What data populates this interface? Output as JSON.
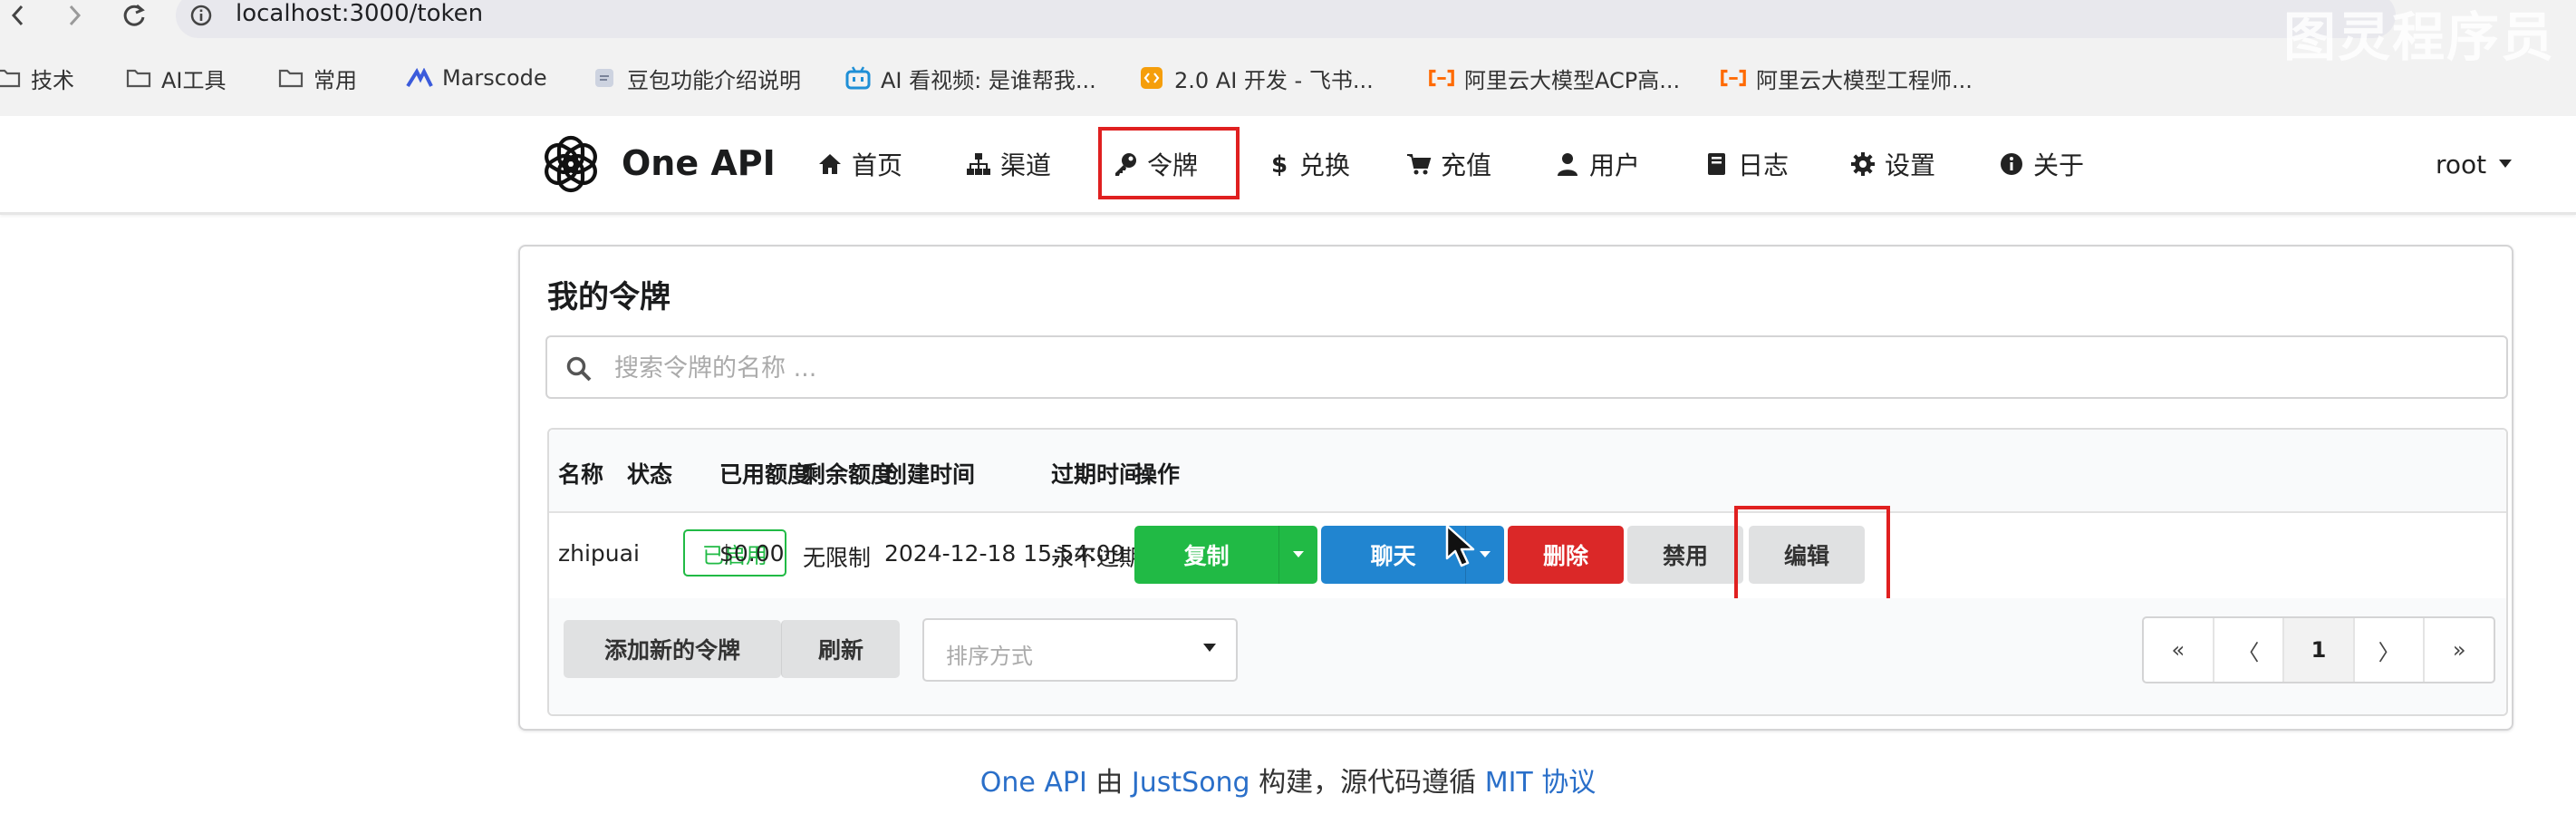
{
  "browser": {
    "url": "localhost:3000/token",
    "watermark": "图灵程序员",
    "bookmarks": [
      {
        "label": "技术",
        "icon": "folder-icon"
      },
      {
        "label": "AI工具",
        "icon": "folder-icon"
      },
      {
        "label": "常用",
        "icon": "folder-icon"
      },
      {
        "label": "Marscode",
        "icon": "marscode-icon"
      },
      {
        "label": "豆包功能介绍说明",
        "icon": "doc-icon"
      },
      {
        "label": "AI 看视频: 是谁帮我...",
        "icon": "bilibili-icon"
      },
      {
        "label": "2.0 AI 开发 - 飞书...",
        "icon": "code-icon"
      },
      {
        "label": "阿里云大模型ACP高...",
        "icon": "aliyun-icon"
      },
      {
        "label": "阿里云大模型工程师...",
        "icon": "aliyun-icon"
      }
    ]
  },
  "app": {
    "brand": "One API",
    "nav": [
      {
        "label": "首页",
        "icon": "home-icon"
      },
      {
        "label": "渠道",
        "icon": "sitemap-icon"
      },
      {
        "label": "令牌",
        "icon": "key-icon"
      },
      {
        "label": "兑换",
        "icon": "dollar-icon"
      },
      {
        "label": "充值",
        "icon": "cart-icon"
      },
      {
        "label": "用户",
        "icon": "user-icon"
      },
      {
        "label": "日志",
        "icon": "book-icon"
      },
      {
        "label": "设置",
        "icon": "gear-icon"
      },
      {
        "label": "关于",
        "icon": "info-icon"
      }
    ],
    "user": "root"
  },
  "tokens": {
    "title": "我的令牌",
    "search_placeholder": "搜索令牌的名称 ...",
    "columns": [
      "名称",
      "状态",
      "已用额度",
      "剩余额度",
      "创建时间",
      "过期时间",
      "操作"
    ],
    "rows": [
      {
        "name": "zhipuai",
        "status": "已启用",
        "used": "$0.00",
        "remaining": "无限制",
        "created": "2024-12-18 15:54:09",
        "expires": "永不过期",
        "actions": {
          "copy": "复制",
          "chat": "聊天",
          "delete": "删除",
          "disable": "禁用",
          "edit": "编辑"
        }
      }
    ],
    "add_button": "添加新的令牌",
    "refresh_button": "刷新",
    "sort_placeholder": "排序方式",
    "pagination": {
      "first": "«",
      "prev": "〈",
      "current": "1",
      "next": "〉",
      "last": "»"
    }
  },
  "footer": {
    "part1": "One API",
    "part2": " 由 ",
    "part3": "JustSong",
    "part4": " 构建，源代码遵循 ",
    "part5": "MIT 协议"
  },
  "colors": {
    "green": "#21ba45",
    "blue": "#2185d0",
    "red": "#db2828",
    "highlight": "#e02020"
  }
}
